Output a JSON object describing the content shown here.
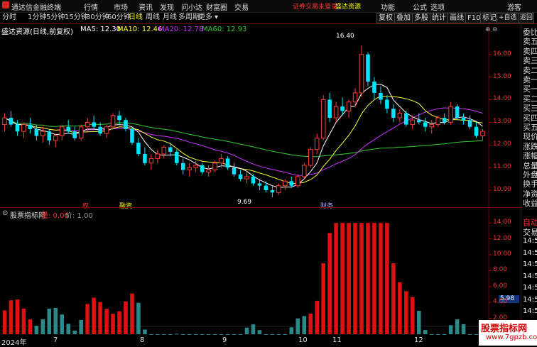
{
  "titlebar": {
    "app_name": "通达信金融终端",
    "menus": [
      "行情",
      "市场",
      "资讯",
      "发现",
      "问小达",
      "财富圈",
      "交易"
    ],
    "login_notice": "证券交易未登录",
    "broker": "盛达资源",
    "right_items": [
      "功能",
      "公式",
      "选项"
    ],
    "guest": "游客"
  },
  "toolbar": {
    "periods": [
      "分时",
      "1分钟",
      "5分钟",
      "15分钟",
      "30分钟",
      "60分钟",
      "日线",
      "周线",
      "月线",
      "多周期",
      "更多"
    ],
    "selected": "日线",
    "right_buttons": [
      "复权",
      "叠加",
      "多股",
      "统计",
      "画线",
      "F10",
      "标记",
      "+自选",
      "返回"
    ]
  },
  "main_chart": {
    "stock_label": "盛达资源(日线,前复权)",
    "ma5": "MA5: 12.30",
    "ma10": "MA10: 12.46",
    "ma20": "MA20: 12.78",
    "ma60": "MA60: 12.93",
    "high_label": "16.40",
    "low_label": "9.69",
    "event_labels": [
      "权",
      "融资",
      "财务"
    ],
    "colors": {
      "up": "#ff3b3b",
      "down": "#00e5ff",
      "ma5": "#ffffff",
      "ma10": "#ffff33",
      "ma20": "#cc33ff",
      "ma60": "#33cc33"
    }
  },
  "indicator": {
    "title": "股票指标网",
    "val_label": "量: 0.00",
    "price_label": "价: 1.00",
    "current_value": "5.98"
  },
  "right_panel": {
    "labels": [
      "委比",
      "卖五",
      "卖四",
      "卖三",
      "卖二",
      "卖一",
      "买一",
      "买二",
      "买三",
      "买四",
      "买五",
      "现价",
      "涨跌",
      "涨幅",
      "总量",
      "外盘",
      "换手",
      "净资",
      "收益"
    ],
    "lower_labels": [
      "自动",
      "交易"
    ],
    "times": [
      "14:56",
      "14:56",
      "14:56",
      "14:56",
      "14:56",
      "14:56",
      "14:56",
      "14:56",
      "14:56"
    ]
  },
  "watermark": {
    "line1": "股票指标网",
    "line2": "www.7gpzb.com"
  },
  "chart_data": [
    {
      "type": "line",
      "title": "盛达资源(日线,前复权)",
      "x_labels": [
        "2024年",
        "7",
        "8",
        "9",
        "10",
        "11",
        "12"
      ],
      "y_ticks": [
        10.0,
        11.0,
        12.0,
        13.0,
        14.0,
        15.0,
        16.0
      ],
      "ylim": [
        9.5,
        16.9
      ],
      "candles": [
        [
          12.9,
          13.4,
          12.6,
          13.2
        ],
        [
          13.2,
          13.5,
          12.8,
          12.9
        ],
        [
          12.9,
          13.1,
          12.4,
          12.6
        ],
        [
          12.6,
          13.0,
          12.3,
          12.9
        ],
        [
          12.9,
          13.2,
          12.5,
          12.7
        ],
        [
          12.7,
          12.9,
          12.2,
          12.4
        ],
        [
          12.4,
          12.8,
          12.1,
          12.6
        ],
        [
          12.6,
          12.7,
          12.0,
          12.2
        ],
        [
          12.2,
          12.5,
          11.9,
          12.4
        ],
        [
          12.4,
          12.9,
          12.2,
          12.8
        ],
        [
          12.8,
          13.1,
          12.5,
          12.6
        ],
        [
          12.6,
          12.8,
          12.2,
          12.3
        ],
        [
          12.3,
          12.9,
          12.2,
          12.8
        ],
        [
          12.8,
          13.2,
          12.6,
          13.0
        ],
        [
          13.0,
          13.3,
          12.7,
          12.8
        ],
        [
          12.8,
          13.0,
          12.4,
          12.5
        ],
        [
          12.5,
          12.9,
          12.3,
          12.8
        ],
        [
          12.8,
          13.4,
          12.7,
          13.3
        ],
        [
          13.3,
          13.5,
          12.9,
          13.1
        ],
        [
          13.1,
          13.2,
          12.6,
          12.7
        ],
        [
          12.7,
          12.8,
          12.0,
          12.1
        ],
        [
          12.1,
          12.3,
          11.5,
          11.6
        ],
        [
          11.6,
          11.9,
          11.1,
          11.2
        ],
        [
          11.2,
          11.6,
          10.9,
          11.4
        ],
        [
          11.4,
          11.8,
          11.2,
          11.6
        ],
        [
          11.6,
          12.0,
          11.4,
          11.9
        ],
        [
          11.9,
          12.1,
          11.5,
          11.7
        ],
        [
          11.7,
          11.8,
          11.1,
          11.2
        ],
        [
          11.2,
          11.4,
          10.7,
          10.9
        ],
        [
          10.9,
          11.2,
          10.6,
          11.0
        ],
        [
          11.0,
          11.3,
          10.8,
          11.1
        ],
        [
          11.1,
          11.2,
          10.7,
          10.8
        ],
        [
          10.8,
          11.1,
          10.6,
          10.9
        ],
        [
          10.9,
          11.3,
          10.8,
          11.2
        ],
        [
          11.2,
          11.6,
          11.0,
          11.4
        ],
        [
          11.4,
          11.5,
          10.9,
          11.0
        ],
        [
          11.0,
          11.2,
          10.6,
          10.7
        ],
        [
          10.7,
          10.9,
          10.4,
          10.5
        ],
        [
          10.5,
          10.8,
          10.3,
          10.6
        ],
        [
          10.6,
          10.7,
          10.2,
          10.3
        ],
        [
          10.3,
          10.5,
          10.0,
          10.2
        ],
        [
          10.2,
          10.4,
          9.9,
          10.0
        ],
        [
          10.0,
          10.2,
          9.69,
          9.9
        ],
        [
          9.9,
          10.3,
          9.8,
          10.2
        ],
        [
          10.2,
          10.5,
          10.0,
          10.4
        ],
        [
          10.4,
          10.6,
          10.1,
          10.2
        ],
        [
          10.2,
          10.7,
          10.1,
          10.6
        ],
        [
          10.6,
          11.2,
          10.5,
          11.1
        ],
        [
          11.1,
          11.9,
          11.0,
          11.8
        ],
        [
          11.8,
          12.5,
          11.6,
          12.3
        ],
        [
          12.3,
          14.2,
          12.2,
          14.0
        ],
        [
          14.0,
          14.3,
          13.0,
          13.2
        ],
        [
          13.2,
          13.9,
          13.0,
          13.7
        ],
        [
          13.7,
          14.1,
          13.3,
          13.5
        ],
        [
          13.5,
          14.0,
          13.2,
          13.9
        ],
        [
          13.9,
          14.5,
          13.7,
          14.3
        ],
        [
          14.3,
          16.4,
          14.1,
          16.0
        ],
        [
          16.0,
          16.1,
          14.6,
          14.8
        ],
        [
          14.8,
          15.0,
          14.0,
          14.3
        ],
        [
          14.3,
          14.6,
          13.8,
          14.0
        ],
        [
          14.0,
          14.2,
          13.4,
          13.6
        ],
        [
          13.6,
          13.8,
          13.0,
          13.2
        ],
        [
          13.2,
          13.6,
          13.0,
          13.4
        ],
        [
          13.4,
          13.5,
          12.8,
          12.9
        ],
        [
          12.9,
          13.3,
          12.7,
          13.1
        ],
        [
          13.1,
          13.4,
          12.9,
          13.0
        ],
        [
          13.0,
          13.2,
          12.6,
          12.8
        ],
        [
          12.8,
          13.1,
          12.5,
          12.9
        ],
        [
          12.9,
          13.3,
          12.8,
          13.2
        ],
        [
          13.2,
          13.4,
          12.9,
          13.0
        ],
        [
          13.0,
          13.9,
          12.9,
          13.7
        ],
        [
          13.7,
          13.8,
          13.1,
          13.2
        ],
        [
          13.2,
          13.4,
          12.9,
          13.1
        ],
        [
          13.1,
          13.3,
          12.7,
          12.8
        ],
        [
          12.8,
          13.0,
          12.3,
          12.4
        ],
        [
          12.4,
          12.7,
          12.2,
          12.6
        ]
      ]
    },
    {
      "type": "bar",
      "title": "股票指标网",
      "y_ticks": [
        2.0,
        4.0,
        6.0,
        8.0,
        10.0,
        12.0,
        14.0
      ],
      "ylim": [
        0,
        15
      ],
      "current": 5.98
    }
  ]
}
